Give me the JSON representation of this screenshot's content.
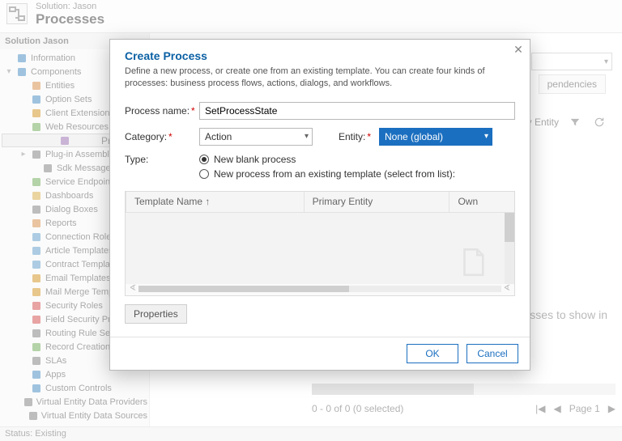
{
  "header": {
    "solution_label": "Solution: Jason",
    "title": "Processes"
  },
  "sidebar": {
    "heading": "Solution Jason",
    "nodes": [
      {
        "label": "Information",
        "icon": "info"
      },
      {
        "label": "Components",
        "icon": "components",
        "expanded": true
      },
      {
        "label": "Entities",
        "icon": "entity",
        "indent": 1
      },
      {
        "label": "Option Sets",
        "icon": "optionset",
        "indent": 1
      },
      {
        "label": "Client Extensions",
        "icon": "client",
        "indent": 1
      },
      {
        "label": "Web Resources",
        "icon": "web",
        "indent": 1
      },
      {
        "label": "Processes",
        "icon": "process",
        "indent": 1,
        "selected": true
      },
      {
        "label": "Plug-in Assemblies",
        "icon": "plugin",
        "indent": 1,
        "expandable": true
      },
      {
        "label": "Sdk Message Proc",
        "icon": "sdk",
        "indent": 2
      },
      {
        "label": "Service Endpoints",
        "icon": "endpoint",
        "indent": 1
      },
      {
        "label": "Dashboards",
        "icon": "dashboard",
        "indent": 1
      },
      {
        "label": "Dialog Boxes",
        "icon": "dialogbox",
        "indent": 1
      },
      {
        "label": "Reports",
        "icon": "report",
        "indent": 1
      },
      {
        "label": "Connection Roles",
        "icon": "connrole",
        "indent": 1
      },
      {
        "label": "Article Templates",
        "icon": "article",
        "indent": 1
      },
      {
        "label": "Contract Template",
        "icon": "contract",
        "indent": 1
      },
      {
        "label": "Email Templates",
        "icon": "email",
        "indent": 1
      },
      {
        "label": "Mail Merge Templ",
        "icon": "mailmerge",
        "indent": 1
      },
      {
        "label": "Security Roles",
        "icon": "secrole",
        "indent": 1
      },
      {
        "label": "Field Security Profi",
        "icon": "fieldsec",
        "indent": 1
      },
      {
        "label": "Routing Rule Sets",
        "icon": "routing",
        "indent": 1
      },
      {
        "label": "Record Creation an",
        "icon": "recordcreate",
        "indent": 1
      },
      {
        "label": "SLAs",
        "icon": "sla",
        "indent": 1
      },
      {
        "label": "Apps",
        "icon": "apps",
        "indent": 1
      },
      {
        "label": "Custom Controls",
        "icon": "customctl",
        "indent": 1
      },
      {
        "label": "Virtual Entity Data Providers",
        "icon": "vedp",
        "indent": 1
      },
      {
        "label": "Virtual Entity Data Sources",
        "icon": "veds",
        "indent": 1
      }
    ]
  },
  "main": {
    "tab_dependencies": "pendencies",
    "col_primary_entity": "ary Entity",
    "empty_message": "rocesses to show in",
    "pager_status": "0 - 0 of 0 (0 selected)",
    "page_label": "Page 1"
  },
  "status_bar": "Status: Existing",
  "dialog": {
    "title": "Create Process",
    "description": "Define a new process, or create one from an existing template. You can create four kinds of processes: business process flows, actions, dialogs, and workflows.",
    "labels": {
      "process_name": "Process name:",
      "category": "Category:",
      "entity": "Entity:",
      "type": "Type:"
    },
    "values": {
      "process_name": "SetProcessState",
      "category": "Action",
      "entity": "None (global)"
    },
    "radios": {
      "new_blank": "New blank process",
      "from_template": "New process from an existing template (select from list):"
    },
    "template_cols": {
      "name": "Template Name ↑",
      "primary_entity": "Primary Entity",
      "owner": "Own"
    },
    "properties_btn": "Properties",
    "ok": "OK",
    "cancel": "Cancel"
  }
}
